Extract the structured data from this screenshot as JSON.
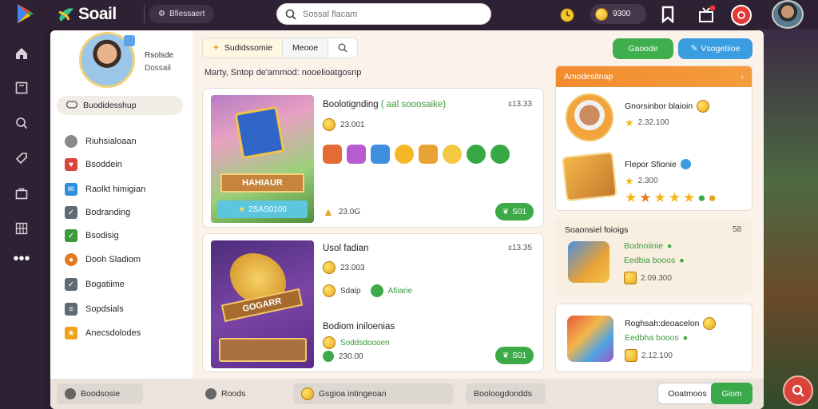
{
  "topbar": {
    "brand": "Soail",
    "status_pill": "Bfiessaert",
    "search_placeholder": "Sossal flacam",
    "coins": "9300"
  },
  "sidebar": {
    "profile_name": "Rsolsde",
    "profile_status": "Dossail",
    "membership": "Buodidesshup",
    "items": [
      {
        "label": "Riuhsialoaan",
        "color": "#8a8a8a"
      },
      {
        "label": "Bsoddein",
        "color": "#d9453a"
      },
      {
        "label": "Raolkt himigian",
        "color": "#2f8fd8"
      },
      {
        "label": "Bodranding",
        "color": "#5e6a74"
      },
      {
        "label": "Bsodisig",
        "color": "#3c9a3d"
      },
      {
        "label": "Dooh Sladiom",
        "color": "#e07a1f"
      },
      {
        "label": "Bogatiime",
        "color": "#5e6a74"
      },
      {
        "label": "Sopdsials",
        "color": "#5e6a74"
      },
      {
        "label": "Anecsdolodes",
        "color": "#f2a21a"
      }
    ]
  },
  "tabs": [
    "Sudidssomie",
    "Meooe",
    ""
  ],
  "breadcrumb": "Marty, Sntop de'ammod: nooelioatgosnp",
  "header_buttons": {
    "green": "Gaoode",
    "blue": "Vsogetiioe"
  },
  "cards": [
    {
      "title": "Boolotignding",
      "title_tag": "( aal sooosaike)",
      "price": "ɛ13.33",
      "rating": "23.001",
      "art_banner": "HAHIAUR",
      "art_label": "2SAS0100",
      "count": "23.0G",
      "play": "S01"
    },
    {
      "title": "Usol fadian",
      "price": "ɛ13.35",
      "rating": "23.003",
      "tag": "Sdaip",
      "tag2": "Afiiarie",
      "sub_title": "Bodiom iniloenias",
      "sub_line": "Soddsdoooen",
      "count": "230.00",
      "art_banner": "GOGARR",
      "play": "S01"
    }
  ],
  "achievements": {
    "header": "Amodesitnap",
    "rows": [
      {
        "title": "Gnorsinbor blaioin",
        "value": "2.32.100"
      },
      {
        "title": "Flepor Sfionie",
        "value": "2.300"
      }
    ]
  },
  "section2": {
    "title": "Soaonsiel foioigs",
    "count": "58",
    "line1": "Bodnoiinie",
    "line2": "Eedbia booos",
    "value": "2.09.300"
  },
  "section3": {
    "title": "Roghsah:deoacelon",
    "line1": "Eedbha booos",
    "value": "2.12.100"
  },
  "footer": {
    "pill1": "Boodsosie",
    "pill2": "Roods",
    "pill3": "Gsgioa intingeoan",
    "pill4": "Booloogdondds",
    "btn_cancel": "Ooatmoos",
    "btn_confirm": "Giom"
  },
  "colors": {
    "accent_green": "#3fae4c",
    "accent_blue": "#3a9ddf",
    "accent_orange": "#f28b2e"
  }
}
